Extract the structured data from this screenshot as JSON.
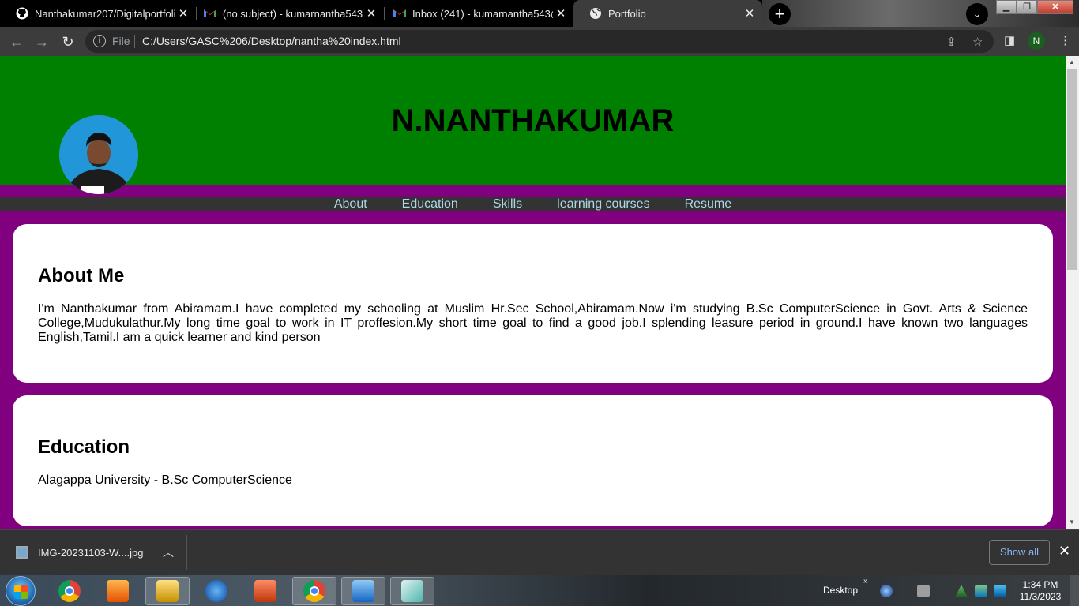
{
  "browser": {
    "tabs": [
      {
        "title": "Nanthakumar207/Digitalportfolio",
        "icon": "github-icon",
        "active": false
      },
      {
        "title": "(no subject) - kumarnantha543@",
        "icon": "gmail-icon",
        "active": false
      },
      {
        "title": "Inbox (241) - kumarnantha543@",
        "icon": "gmail-icon",
        "active": false
      },
      {
        "title": "Portfolio",
        "icon": "globe-icon",
        "active": true
      }
    ],
    "address": {
      "scheme_label": "File",
      "url": "C:/Users/GASC%206/Desktop/nantha%20index.html"
    },
    "profile_initial": "N"
  },
  "page": {
    "header_title": "N.NANTHAKUMAR",
    "nav": [
      "About",
      "Education",
      "Skills",
      "learning courses",
      "Resume"
    ],
    "about": {
      "heading": "About Me",
      "text": "I'm Nanthakumar from Abiramam.I have completed my schooling at Muslim Hr.Sec School,Abiramam.Now i'm studying B.Sc ComputerScience in Govt. Arts & Science College,Mudukulathur.My long time goal to work in IT proffesion.My short time goal to find a good job.I splending leasure period in ground.I have known two languages English,Tamil.I am a quick learner and kind person"
    },
    "education": {
      "heading": "Education",
      "text": "Alagappa University - B.Sc ComputerScience"
    },
    "colors": {
      "header_bg": "#008000",
      "page_bg": "#800080",
      "nav_bg": "#333333",
      "nav_link": "#add8e6"
    }
  },
  "downloads": {
    "file_name": "IMG-20231103-W....jpg",
    "show_all_label": "Show all"
  },
  "taskbar": {
    "desktop_label": "Desktop",
    "time": "1:34 PM",
    "date": "11/3/2023"
  }
}
